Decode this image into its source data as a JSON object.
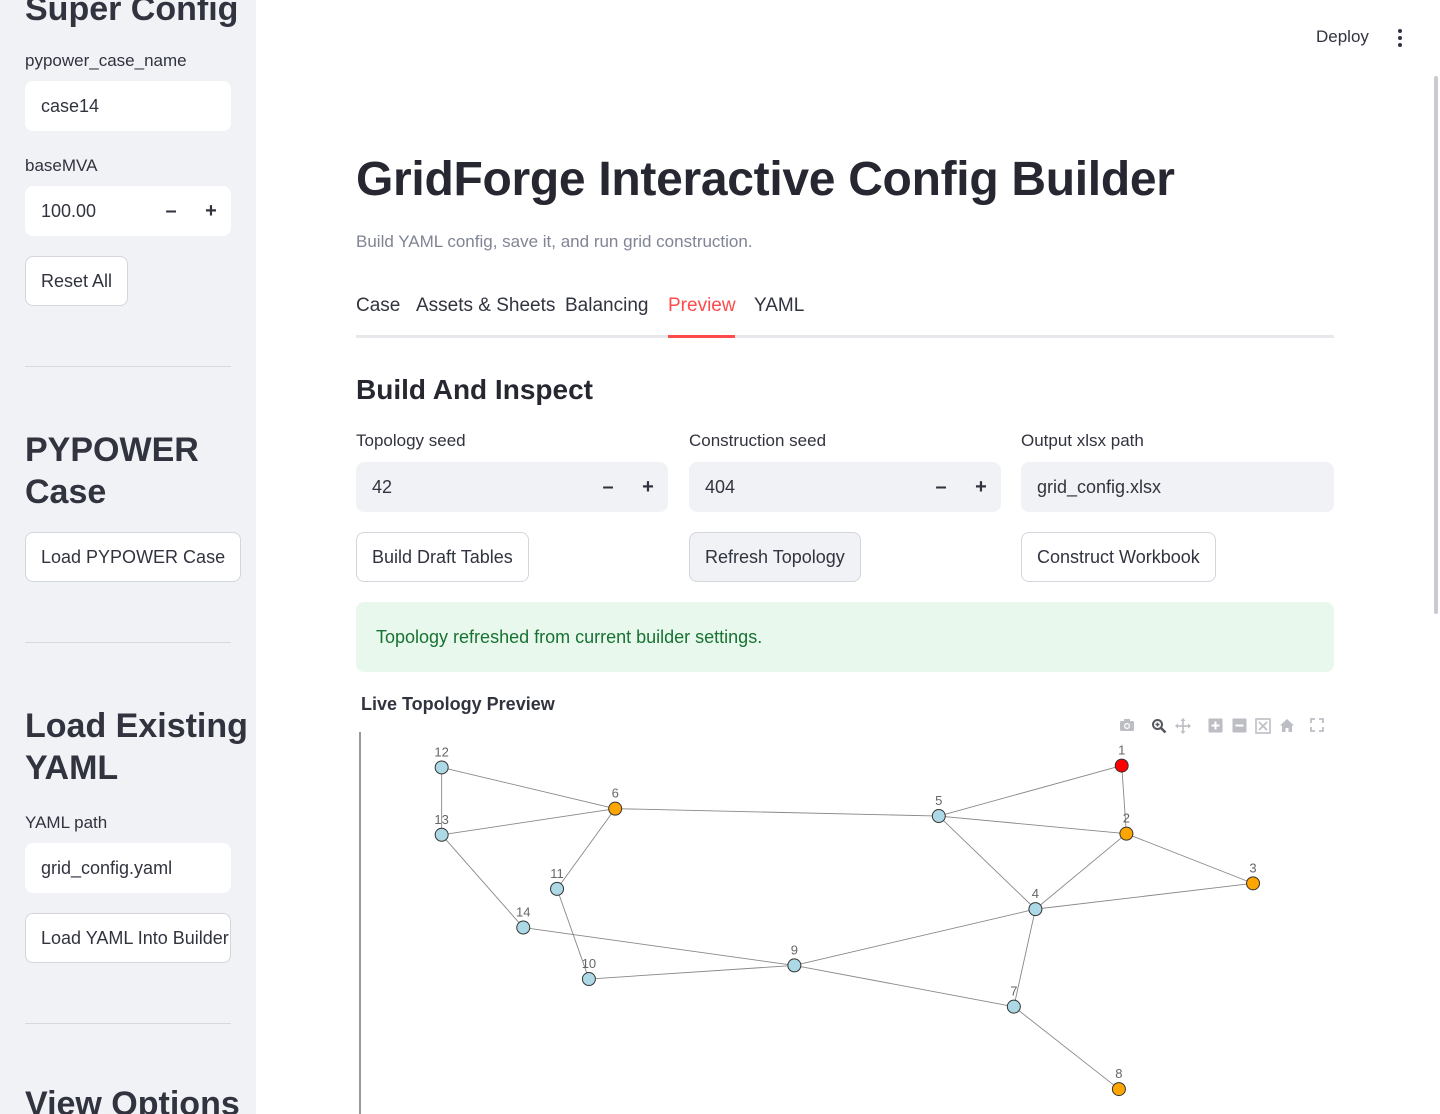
{
  "sidebar": {
    "heading_super": "Super Config",
    "case_name_label": "pypower_case_name",
    "case_name_value": "case14",
    "basemva_label": "baseMVA",
    "basemva_value": "100.00",
    "stepper_minus": "–",
    "stepper_plus": "+",
    "reset_label": "Reset All",
    "heading_pypower_1": "PYPOWER",
    "heading_pypower_2": "Case",
    "load_pypower_label": "Load PYPOWER Case",
    "heading_yaml_1": "Load Existing",
    "heading_yaml_2": "YAML",
    "yaml_path_label": "YAML path",
    "yaml_path_value": "grid_config.yaml",
    "load_yaml_label": "Load YAML Into Builder",
    "heading_view": "View Options"
  },
  "header": {
    "deploy_label": "Deploy"
  },
  "main": {
    "title": "GridForge Interactive Config Builder",
    "subtitle": "Build YAML config, save it, and run grid construction.",
    "tabs": [
      {
        "label": "Case"
      },
      {
        "label": "Assets & Sheets"
      },
      {
        "label": "Balancing"
      },
      {
        "label": "Preview"
      },
      {
        "label": "YAML"
      }
    ],
    "active_tab": "Preview",
    "section_title": "Build And Inspect",
    "topology_seed_label": "Topology seed",
    "topology_seed_value": "42",
    "construction_seed_label": "Construction seed",
    "construction_seed_value": "404",
    "output_path_label": "Output xlsx path",
    "output_path_value": "grid_config.xlsx",
    "build_draft_label": "Build Draft Tables",
    "refresh_topology_label": "Refresh Topology",
    "construct_workbook_label": "Construct Workbook",
    "alert_text": "Topology refreshed from current builder settings.",
    "chart_title": "Live Topology Preview"
  },
  "colors": {
    "accent": "#ff4b4b",
    "success_bg": "#e8f8ec",
    "success_text": "#177233",
    "node_load": "#add8e6",
    "node_gen": "#ffa500",
    "node_slack": "#ff0000"
  },
  "modebar_icons": [
    "camera-icon",
    "zoom-icon",
    "pan-icon",
    "zoom-in-icon",
    "zoom-out-icon",
    "autoscale-icon",
    "home-icon",
    "fullscreen-icon"
  ],
  "chart_data": {
    "type": "scatter",
    "title": "Live Topology Preview",
    "nodes": [
      {
        "id": "1",
        "x": 0.795,
        "y": 0.925,
        "kind": "slack"
      },
      {
        "id": "2",
        "x": 0.8,
        "y": 0.74,
        "kind": "generator"
      },
      {
        "id": "3",
        "x": 0.935,
        "y": 0.605,
        "kind": "generator"
      },
      {
        "id": "4",
        "x": 0.703,
        "y": 0.535,
        "kind": "load"
      },
      {
        "id": "5",
        "x": 0.6,
        "y": 0.788,
        "kind": "load"
      },
      {
        "id": "6",
        "x": 0.255,
        "y": 0.808,
        "kind": "generator"
      },
      {
        "id": "7",
        "x": 0.68,
        "y": 0.27,
        "kind": "load"
      },
      {
        "id": "8",
        "x": 0.792,
        "y": 0.046,
        "kind": "generator"
      },
      {
        "id": "9",
        "x": 0.446,
        "y": 0.382,
        "kind": "load"
      },
      {
        "id": "10",
        "x": 0.227,
        "y": 0.345,
        "kind": "load"
      },
      {
        "id": "11",
        "x": 0.193,
        "y": 0.59,
        "kind": "load"
      },
      {
        "id": "12",
        "x": 0.07,
        "y": 0.92,
        "kind": "load"
      },
      {
        "id": "13",
        "x": 0.07,
        "y": 0.737,
        "kind": "load"
      },
      {
        "id": "14",
        "x": 0.157,
        "y": 0.485,
        "kind": "load"
      }
    ],
    "edges": [
      [
        "1",
        "2"
      ],
      [
        "1",
        "5"
      ],
      [
        "2",
        "3"
      ],
      [
        "2",
        "4"
      ],
      [
        "2",
        "5"
      ],
      [
        "3",
        "4"
      ],
      [
        "4",
        "5"
      ],
      [
        "4",
        "7"
      ],
      [
        "4",
        "9"
      ],
      [
        "5",
        "6"
      ],
      [
        "6",
        "11"
      ],
      [
        "6",
        "12"
      ],
      [
        "6",
        "13"
      ],
      [
        "7",
        "8"
      ],
      [
        "7",
        "9"
      ],
      [
        "9",
        "10"
      ],
      [
        "9",
        "14"
      ],
      [
        "10",
        "11"
      ],
      [
        "12",
        "13"
      ],
      [
        "13",
        "14"
      ]
    ]
  }
}
